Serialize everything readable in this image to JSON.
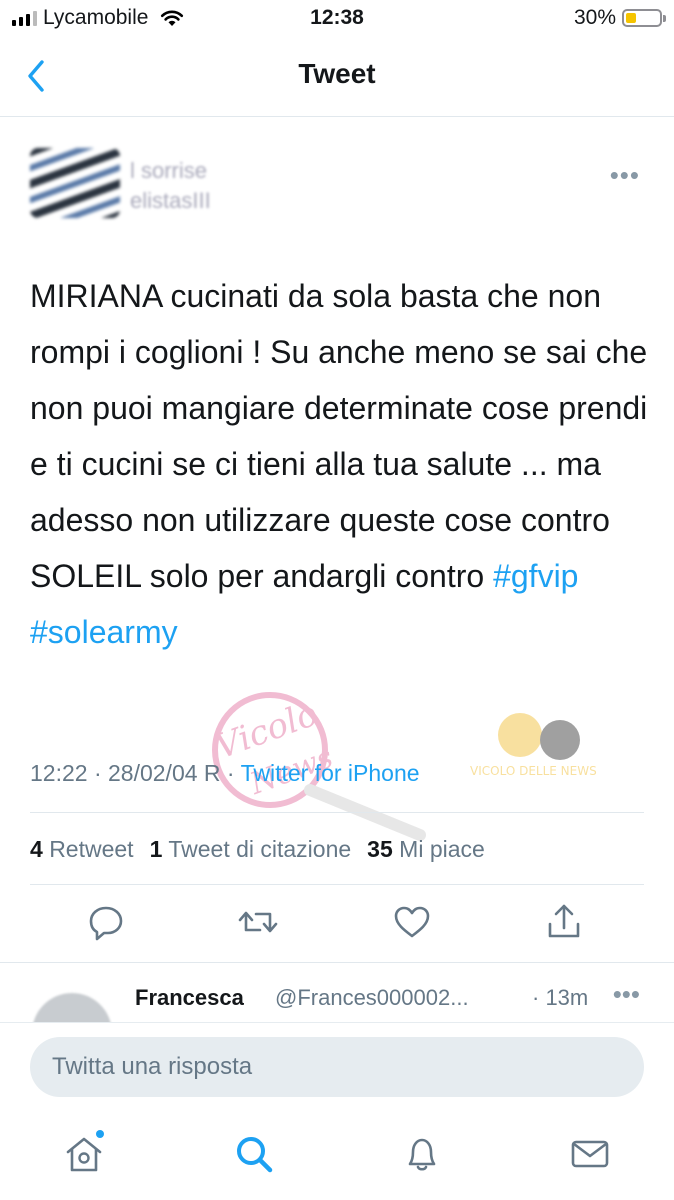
{
  "status_bar": {
    "carrier": "Lycamobile",
    "time": "12:38",
    "battery_percent": "30%",
    "battery_level": 0.3,
    "battery_color": "#f5c400"
  },
  "nav": {
    "back_icon": "chevron-left-icon",
    "title": "Tweet"
  },
  "tweet": {
    "author_name_obscured": "l sorrise",
    "author_handle_obscured": "elistasIII",
    "text_segments": [
      "MIRIANA cucinati da sola basta che non rompi i coglioni ! Su anche meno se sai che non puoi mangiare determinate cose prendi e ti cucini se ci tieni alla tua salute ... ma adesso non utilizzare queste cose contro SOLEIL solo per andargli contro "
    ],
    "hashtags": [
      "#gfvip",
      "#solearmy"
    ],
    "timestamp": "12:22 · 28/02/04 R",
    "source": "Twitter for iPhone",
    "stats": {
      "retweets_count": "4",
      "retweets_label": "Retweet",
      "quotes_count": "1",
      "quotes_label": "Tweet di citazione",
      "likes_count": "35",
      "likes_label": "Mi piace"
    },
    "actions": [
      "reply-icon",
      "retweet-icon",
      "like-icon",
      "share-icon"
    ]
  },
  "reply_preview": {
    "name": "Francesca",
    "handle": "@Frances000002...",
    "time": "· 13m",
    "more": "•••"
  },
  "compose": {
    "placeholder": "Twitta una risposta"
  },
  "tabbar": {
    "items": [
      "home-icon",
      "search-icon",
      "notifications-icon",
      "messages-icon"
    ],
    "accent": "#1da1f2"
  },
  "colors": {
    "link": "#1da1f2",
    "secondary_text": "#657786",
    "divider": "#e1e8ed"
  },
  "watermark": {
    "text": "Vicolo delle News"
  }
}
